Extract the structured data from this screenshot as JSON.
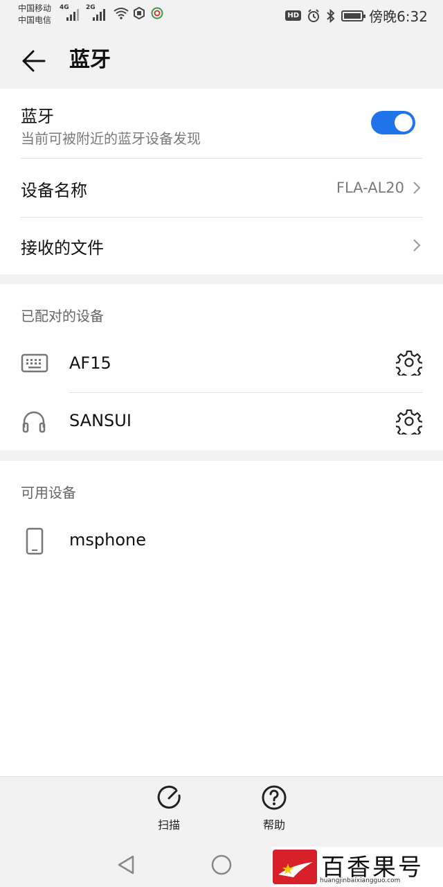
{
  "status_bar": {
    "carrier1": "中国移动",
    "carrier2": "中国电信",
    "net1": "4G",
    "net2": "2G",
    "hd_label": "HD",
    "time": "傍晚6:32"
  },
  "app_bar": {
    "title": "蓝牙"
  },
  "bluetooth": {
    "label": "蓝牙",
    "subtitle": "当前可被附近的蓝牙设备发现",
    "enabled": true
  },
  "device_name": {
    "label": "设备名称",
    "value": "FLA-AL20"
  },
  "received_files": {
    "label": "接收的文件"
  },
  "paired": {
    "header": "已配对的设备",
    "devices": [
      {
        "name": "AF15",
        "icon": "keyboard-icon"
      },
      {
        "name": "SANSUI",
        "icon": "headphones-icon"
      }
    ]
  },
  "available": {
    "header": "可用设备",
    "devices": [
      {
        "name": "msphone",
        "icon": "phone-icon"
      }
    ]
  },
  "actions": {
    "scan": "扫描",
    "help": "帮助"
  },
  "watermark": {
    "text": "百香果号",
    "url": "huangjinbaixiangguo.com"
  },
  "colors": {
    "accent": "#1e74e8",
    "background": "#f2f2f2"
  }
}
